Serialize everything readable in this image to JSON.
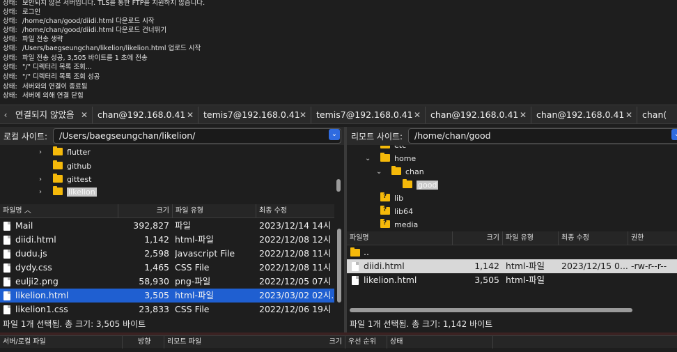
{
  "log": {
    "lines": [
      {
        "label": "상태:",
        "text": "보안되지 않은 서버입니다. TLS를 통한 FTP를 지원하지 않습니다."
      },
      {
        "label": "상태:",
        "text": "로그인"
      },
      {
        "label": "상태:",
        "text": "/home/chan/good/diidi.html 다운로드 시작"
      },
      {
        "label": "상태:",
        "text": "/home/chan/good/diidi.html 다운로드 건너뛰기"
      },
      {
        "label": "상태:",
        "text": "파일 전송 생략"
      },
      {
        "label": "상태:",
        "text": "/Users/baegseungchan/likelion/likelion.html 업로드 시작"
      },
      {
        "label": "상태:",
        "text": "파일 전송 성공, 3,505 바이트를 1 초에 전송"
      },
      {
        "label": "상태:",
        "text": "\"/\" 디렉터리 목록 조회..."
      },
      {
        "label": "상태:",
        "text": "\"/\" 디렉터리 목록 조회 성공"
      },
      {
        "label": "상태:",
        "text": "서버와의 연결이 종료됨"
      },
      {
        "label": "상태:",
        "text": "서버에 의해 연결 닫힘"
      }
    ]
  },
  "tabs": [
    {
      "label": "연결되지 않았음"
    },
    {
      "label": "chan@192.168.0.41"
    },
    {
      "label": "temis7@192.168.0.41"
    },
    {
      "label": "temis7@192.168.0.41"
    },
    {
      "label": "chan@192.168.0.41"
    },
    {
      "label": "chan@192.168.0.41"
    },
    {
      "label": "chan("
    }
  ],
  "local": {
    "site_label": "로컬 사이트:",
    "path": "/Users/baegseungchan/likelion/",
    "tree": [
      {
        "name": "flutter"
      },
      {
        "name": "github"
      },
      {
        "name": "gittest"
      },
      {
        "name": "likelion"
      }
    ],
    "columns": {
      "name": "파일명",
      "size": "크기",
      "type": "파일 유형",
      "modified": "최종 수정"
    },
    "files": [
      {
        "name": "Mail",
        "size": "392,827",
        "type": "파일",
        "modified": "2023/12/14 14시 .."
      },
      {
        "name": "diidi.html",
        "size": "1,142",
        "type": "html-파일",
        "modified": "2022/12/08 12시 .."
      },
      {
        "name": "dudu.js",
        "size": "2,598",
        "type": "Javascript File",
        "modified": "2022/12/08 11시 .."
      },
      {
        "name": "dydy.css",
        "size": "1,465",
        "type": "CSS File",
        "modified": "2022/12/08 11시 .."
      },
      {
        "name": "eulji2.png",
        "size": "58,930",
        "type": "png-파일",
        "modified": "2022/12/05 07시 .."
      },
      {
        "name": "likelion.html",
        "size": "3,505",
        "type": "html-파일",
        "modified": "2023/03/02 02시.."
      },
      {
        "name": "likelion1.css",
        "size": "23,833",
        "type": "CSS File",
        "modified": "2022/12/06 19시 .."
      }
    ],
    "status": "파일 1개 선택됨. 총 크기: 3,505 바이트"
  },
  "remote": {
    "site_label": "리모트 사이트:",
    "path": "/home/chan/good",
    "tree": [
      {
        "name": "etc"
      },
      {
        "name": "home"
      },
      {
        "name": "chan"
      },
      {
        "name": "good"
      },
      {
        "name": "lib"
      },
      {
        "name": "lib64"
      },
      {
        "name": "media"
      }
    ],
    "columns": {
      "name": "파일명",
      "size": "크기",
      "type": "파일 유형",
      "modified": "최종 수정",
      "perm": "권한"
    },
    "files": [
      {
        "name": "..",
        "size": "",
        "type": "",
        "modified": "",
        "perm": ""
      },
      {
        "name": "diidi.html",
        "size": "1,142",
        "type": "html-파일",
        "modified": "2023/12/15 0...",
        "perm": "-rw-r--r--"
      },
      {
        "name": "likelion.html",
        "size": "3,505",
        "type": "html-파일",
        "modified": "",
        "perm": ""
      }
    ],
    "status": "파일 1개 선택됨. 총 크기: 1,142 바이트"
  },
  "queue": {
    "columns": [
      "서버/로컬 파일",
      "방향",
      "리모트 파일",
      "크기",
      "우선 순위",
      "상태"
    ]
  }
}
